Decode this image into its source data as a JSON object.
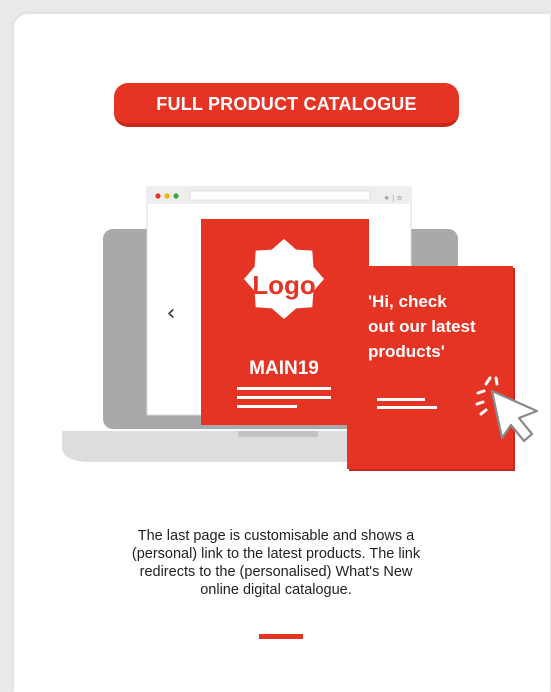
{
  "badge": {
    "label": "FULL PRODUCT CATALOGUE"
  },
  "cover": {
    "logo_text": "Logo",
    "code_text": "MAIN19"
  },
  "browser": {
    "nav_arrow": "‹",
    "toolbar_text": "★ | ≡"
  },
  "message": {
    "lines": [
      "'Hi, check",
      "out our latest",
      "products'"
    ]
  },
  "caption": {
    "lines": [
      "The last page is customisable and shows a",
      "(personal) link to the latest products. The link",
      "redirects to the (personalised) What's New",
      "online digital catalogue."
    ]
  },
  "colors": {
    "accent": "#e63424",
    "accent_dark": "#c8281b",
    "laptop_frame": "#a7a9ab",
    "laptop_base": "#dcdddf",
    "browser_dot_red": "#e63424",
    "browser_dot_yellow": "#f5b400",
    "browser_dot_green": "#3aa935"
  },
  "icons": [
    "badge-icon",
    "cursor-icon",
    "click-rays-icon",
    "chevron-left-icon"
  ]
}
